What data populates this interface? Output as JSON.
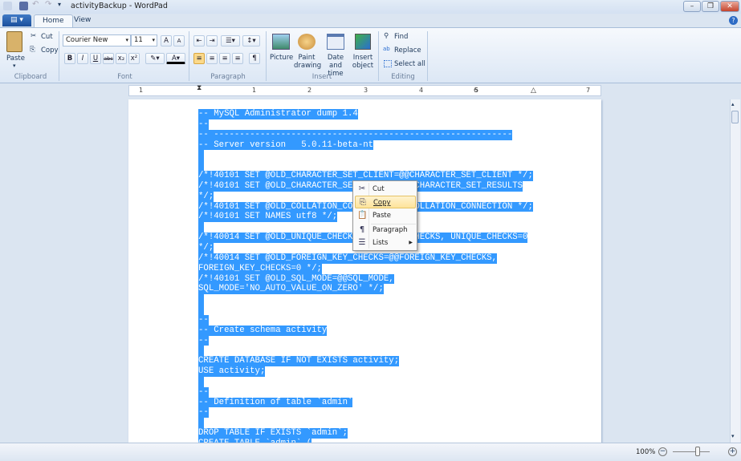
{
  "window": {
    "title": "activityBackup - WordPad",
    "controls": [
      "minimize",
      "restore",
      "close"
    ]
  },
  "tabs": [
    {
      "label": "Home",
      "active": true
    },
    {
      "label": "View",
      "active": false
    }
  ],
  "ribbon": {
    "clipboard": {
      "group": "Clipboard",
      "paste": "Paste",
      "cut": "Cut",
      "copy": "Copy"
    },
    "font": {
      "group": "Font",
      "family": "Courier New",
      "size": "11",
      "buttons": [
        "B",
        "I",
        "U",
        "abc",
        "x₂",
        "x²"
      ]
    },
    "paragraph": {
      "group": "Paragraph"
    },
    "insert": {
      "group": "Insert",
      "picture": "Picture",
      "paint": "Paint drawing",
      "datetime": "Date and time",
      "object": "Insert object"
    },
    "editing": {
      "group": "Editing",
      "find": "Find",
      "replace": "Replace",
      "select_all": "Select all"
    }
  },
  "ruler": {
    "marks": [
      "1",
      "1",
      "2",
      "3",
      "4",
      "5",
      "6",
      "7"
    ]
  },
  "document": {
    "lines": [
      "-- MySQL Administrator dump 1.4",
      "--",
      "-- ----------------------------------------------------------",
      "-- Server version\t5.0.11-beta-nt",
      "",
      "",
      "/*!40101 SET @OLD_CHARACTER_SET_CLIENT=@@CHARACTER_SET_CLIENT */;",
      "/*!40101 SET @OLD_CHARACTER_SET_RESULTS=@@CHARACTER_SET_RESULTS",
      "*/;",
      "/*!40101 SET @OLD_COLLATION_CONNECTION=@@COLLATION_CONNECTION */;",
      "/*!40101 SET NAMES utf8 */;",
      "",
      "/*!40014 SET @OLD_UNIQUE_CHECKS=@@UNIQUE_CHECKS, UNIQUE_CHECKS=0",
      "*/;",
      "/*!40014 SET @OLD_FOREIGN_KEY_CHECKS=@@FOREIGN_KEY_CHECKS,",
      "FOREIGN_KEY_CHECKS=0 */;",
      "/*!40101 SET @OLD_SQL_MODE=@@SQL_MODE,",
      "SQL_MODE='NO_AUTO_VALUE_ON_ZERO' */;",
      "",
      "",
      "--",
      "-- Create schema activity",
      "--",
      "",
      "CREATE DATABASE IF NOT EXISTS activity;",
      "USE activity;",
      "",
      "--",
      "-- Definition of table `admin`",
      "--",
      "",
      "DROP TABLE IF EXISTS `admin`;",
      "CREATE TABLE `admin` ("
    ]
  },
  "context_menu": {
    "items": [
      {
        "label": "Cut",
        "icon": "scissors-icon"
      },
      {
        "label": "Copy",
        "icon": "copy-icon",
        "highlighted": true
      },
      {
        "label": "Paste",
        "icon": "paste-icon"
      },
      {
        "label": "Paragraph",
        "icon": "paragraph-icon"
      },
      {
        "label": "Lists",
        "icon": "list-icon",
        "submenu": true
      }
    ]
  },
  "status": {
    "zoom": "100%"
  },
  "colors": {
    "selection": "#3399ff",
    "menu_highlight": "#fde39a"
  }
}
